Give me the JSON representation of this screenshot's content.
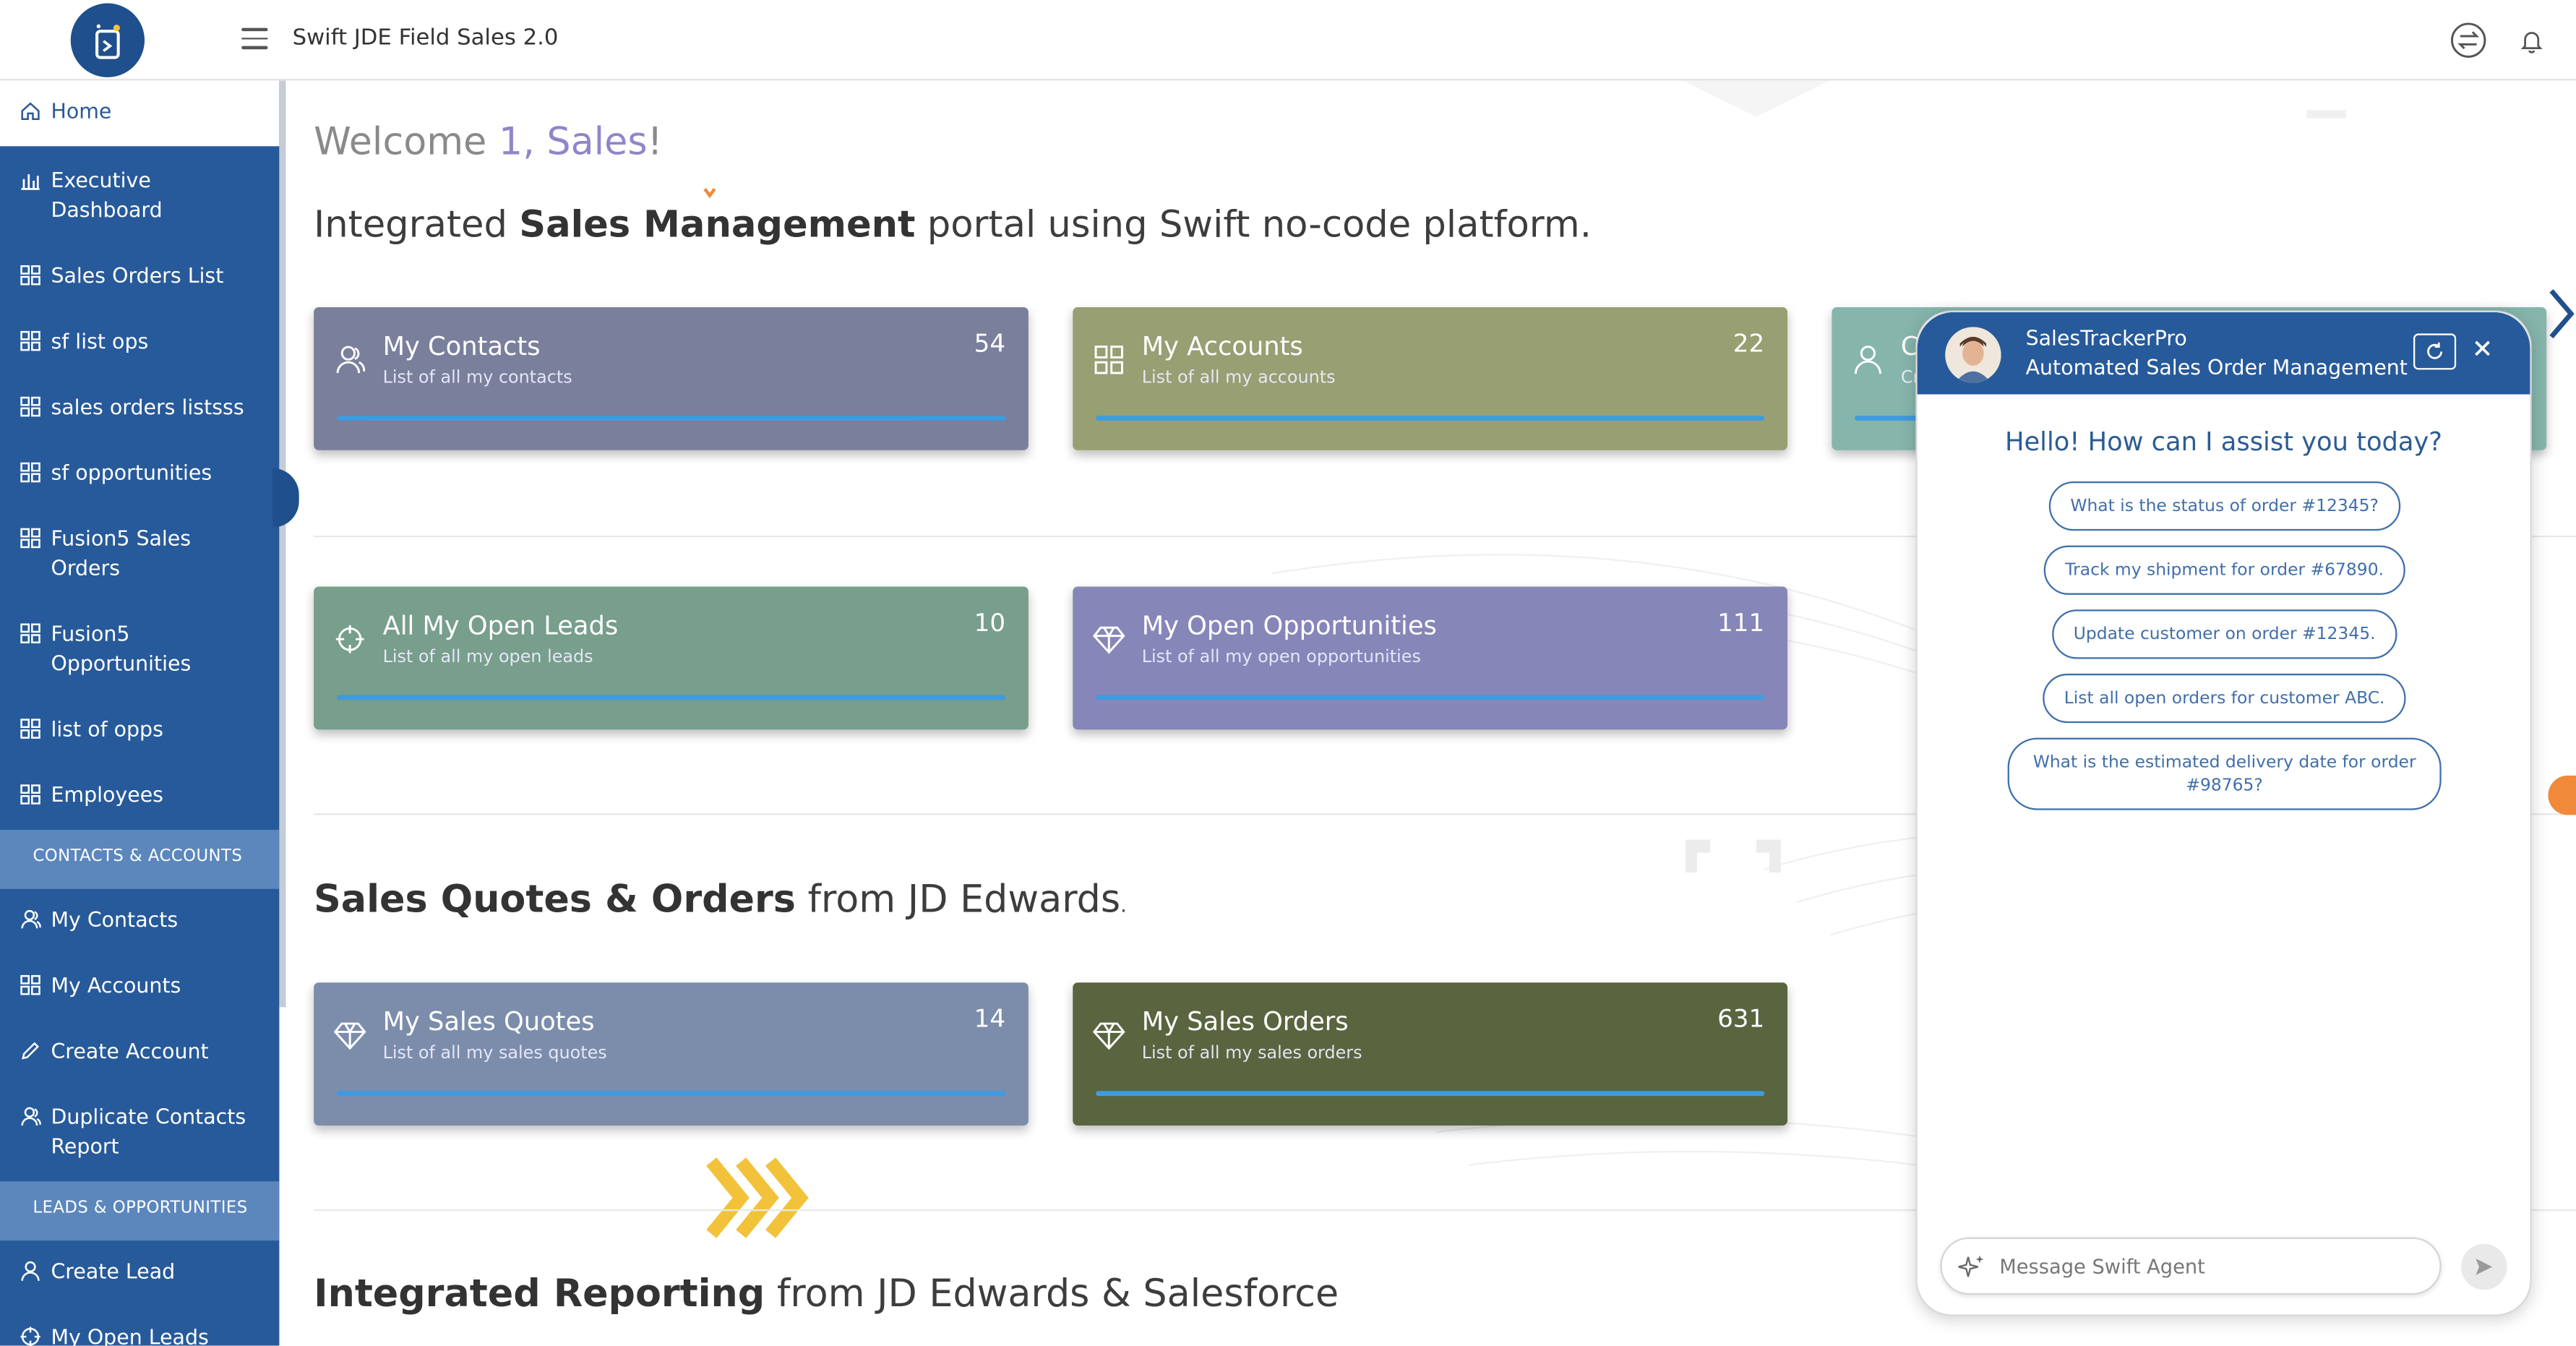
{
  "app": {
    "title": "Swift JDE Field Sales 2.0"
  },
  "sidebar": {
    "items": [
      {
        "label": "Home",
        "icon": "home-icon",
        "active": true
      },
      {
        "label": "Executive Dashboard",
        "icon": "bar-chart-icon"
      },
      {
        "label": "Sales Orders List",
        "icon": "grid-icon"
      },
      {
        "label": "sf list ops",
        "icon": "grid-icon"
      },
      {
        "label": "sales orders listsss",
        "icon": "grid-icon"
      },
      {
        "label": "sf opportunities",
        "icon": "grid-icon"
      },
      {
        "label": "Fusion5 Sales Orders",
        "icon": "grid-icon"
      },
      {
        "label": "Fusion5 Opportunities",
        "icon": "grid-icon"
      },
      {
        "label": "list of opps",
        "icon": "grid-icon"
      },
      {
        "label": "Employees",
        "icon": "grid-icon"
      }
    ],
    "section_contacts": "CONTACTS & ACCOUNTS",
    "contacts_items": [
      {
        "label": "My Contacts",
        "icon": "users-icon"
      },
      {
        "label": "My Accounts",
        "icon": "grid-icon"
      },
      {
        "label": "Create Account",
        "icon": "pencil-icon"
      },
      {
        "label": "Duplicate Contacts Report",
        "icon": "users-icon"
      }
    ],
    "section_leads": "LEADS & OPPORTUNITIES",
    "leads_items": [
      {
        "label": "Create Lead",
        "icon": "user-icon"
      },
      {
        "label": "My Open Leads",
        "icon": "crosshair-icon"
      }
    ]
  },
  "main": {
    "welcome_prefix": "Welcome ",
    "welcome_name": "1, Sales",
    "welcome_suffix": "!",
    "subtitle_pre": "Integrated ",
    "subtitle_bold": "Sales Management",
    "subtitle_post": " portal using Swift no-code platform.",
    "sales_heading_bold": "Sales Quotes & Orders",
    "sales_heading_rest": " from JD Edwards",
    "sales_heading_end": ".",
    "reporting_heading_bold": "Integrated Reporting",
    "reporting_heading_rest": " from JD Edwards & Salesforce",
    "cards": [
      {
        "title": "My Contacts",
        "sub": "List of all my contacts",
        "count": "54",
        "color": "#7a7f9c",
        "icon": "users-icon"
      },
      {
        "title": "My Accounts",
        "sub": "List of all my accounts",
        "count": "22",
        "color": "#979f73",
        "icon": "grid-icon"
      },
      {
        "title": "C",
        "sub": "Cr",
        "count": "",
        "color": "#86b5ac",
        "icon": "user-icon"
      },
      {
        "title": "All My Open Leads",
        "sub": "List of all my open leads",
        "count": "10",
        "color": "#789e8c",
        "icon": "crosshair-icon"
      },
      {
        "title": "My Open Opportunities",
        "sub": "List of all my open opportunities",
        "count": "111",
        "color": "#8686b9",
        "icon": "diamond-icon"
      },
      {
        "title": "My Sales Quotes",
        "sub": "List of all my sales quotes",
        "count": "14",
        "color": "#7c8dac",
        "icon": "diamond-icon"
      },
      {
        "title": "My Sales Orders",
        "sub": "List of all my sales orders",
        "count": "631",
        "color": "#59653f",
        "icon": "diamond-icon"
      }
    ]
  },
  "chat": {
    "agent_name": "SalesTrackerPro",
    "agent_desc": "Automated Sales Order Management",
    "greeting": "Hello! How can I assist you today?",
    "suggestions": [
      "What is the status of order #12345?",
      "Track my shipment for order #67890.",
      "Update customer on order #12345.",
      "List all open orders for customer ABC.",
      "What is the estimated delivery date for order #98765?"
    ],
    "input_placeholder": "Message Swift Agent"
  },
  "colors": {
    "primary": "#275a9a",
    "section": "#5b87bd",
    "accent_bar": "#3d9be0",
    "chevron": "#f2c23a"
  }
}
